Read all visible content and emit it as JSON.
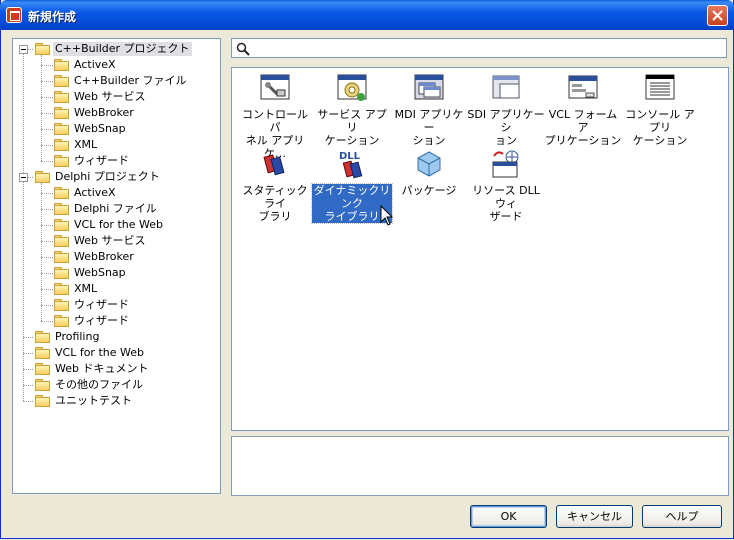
{
  "window": {
    "title": "新規作成"
  },
  "search": {
    "value": ""
  },
  "tree": {
    "items": [
      {
        "label": "C++Builder プロジェクト",
        "level": 0,
        "expanded": true,
        "selected": true
      },
      {
        "label": "ActiveX",
        "level": 1
      },
      {
        "label": "C++Builder ファイル",
        "level": 1
      },
      {
        "label": "Web サービス",
        "level": 1
      },
      {
        "label": "WebBroker",
        "level": 1
      },
      {
        "label": "WebSnap",
        "level": 1
      },
      {
        "label": "XML",
        "level": 1
      },
      {
        "label": "ウィザード",
        "level": 1
      },
      {
        "label": "Delphi プロジェクト",
        "level": 0,
        "expanded": true
      },
      {
        "label": "ActiveX",
        "level": 1
      },
      {
        "label": "Delphi ファイル",
        "level": 1
      },
      {
        "label": "VCL for the Web",
        "level": 1
      },
      {
        "label": "Web サービス",
        "level": 1
      },
      {
        "label": "WebBroker",
        "level": 1
      },
      {
        "label": "WebSnap",
        "level": 1
      },
      {
        "label": "XML",
        "level": 1
      },
      {
        "label": "ウィザード",
        "level": 1
      },
      {
        "label": "ウィザード",
        "level": 1
      },
      {
        "label": "Profiling",
        "level": 0
      },
      {
        "label": "VCL for the Web",
        "level": 0
      },
      {
        "label": "Web ドキュメント",
        "level": 0
      },
      {
        "label": "その他のファイル",
        "level": 0
      },
      {
        "label": "ユニットテスト",
        "level": 0
      }
    ]
  },
  "items": [
    {
      "line1": "コントロール パ",
      "line2": "ネル アプリケ…",
      "icon": "control-panel-app-icon"
    },
    {
      "line1": "サービス アプリ",
      "line2": "ケーション",
      "icon": "service-app-icon"
    },
    {
      "line1": "MDI アプリケー",
      "line2": "ション",
      "icon": "mdi-app-icon"
    },
    {
      "line1": "SDI アプリケーシ",
      "line2": "ョン",
      "icon": "sdi-app-icon"
    },
    {
      "line1": "VCL フォーム ア",
      "line2": "プリケーション",
      "icon": "vcl-forms-app-icon"
    },
    {
      "line1": "コンソール アプリ",
      "line2": "ケーション",
      "icon": "console-app-icon"
    },
    {
      "line1": "スタティック ライ",
      "line2": "ブラリ",
      "icon": "static-library-icon"
    },
    {
      "line1": "ダイナミックリンク",
      "line2": "ライブラリ",
      "icon": "dll-icon",
      "selected": true
    },
    {
      "line1": "パッケージ",
      "line2": "",
      "icon": "package-icon"
    },
    {
      "line1": "リソース DLL ウィ",
      "line2": "ザード",
      "icon": "resource-dll-wizard-icon"
    }
  ],
  "buttons": {
    "ok": "OK",
    "cancel": "キャンセル",
    "help": "ヘルプ"
  }
}
